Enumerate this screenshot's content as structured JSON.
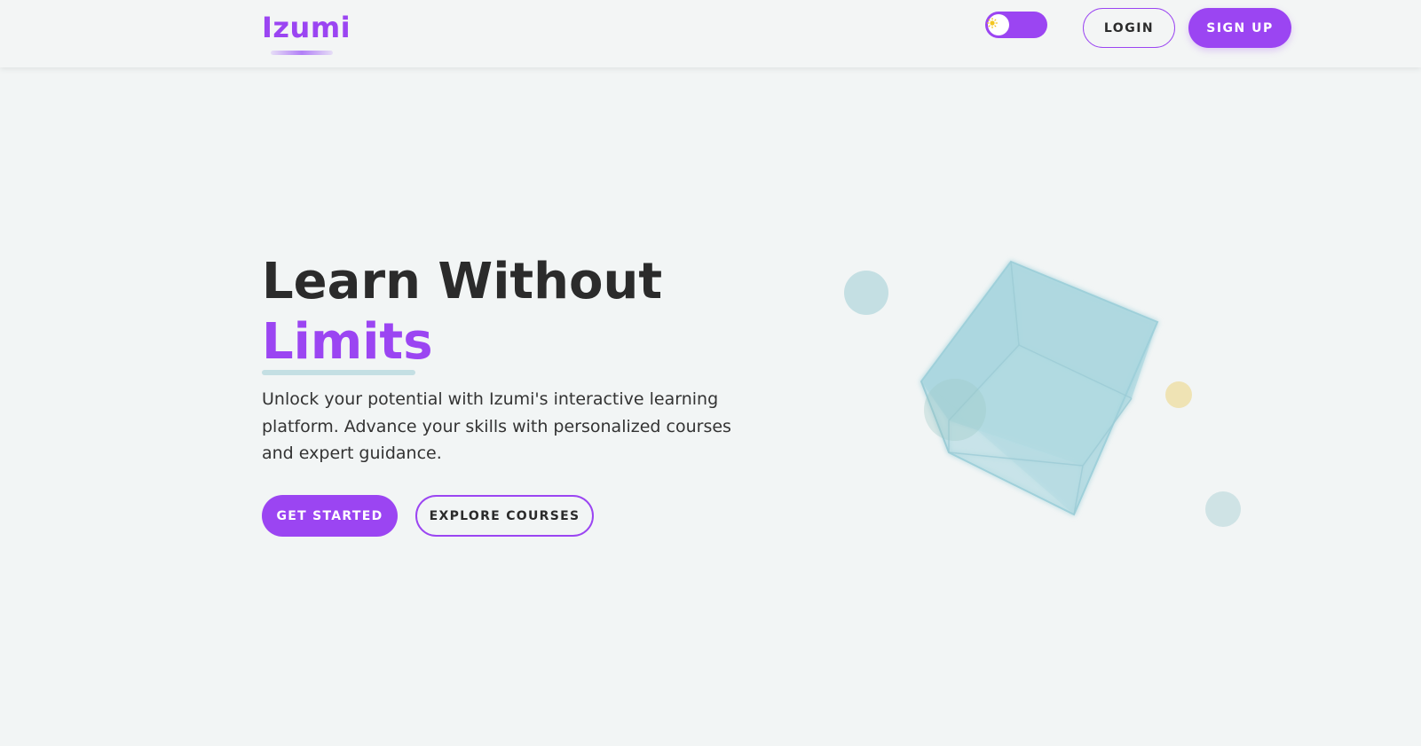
{
  "header": {
    "logo": "Izumi",
    "login_label": "LOGIN",
    "signup_label": "SIGN UP",
    "theme_toggle": {
      "state": "light",
      "icon": "sun-icon"
    }
  },
  "hero": {
    "title_line1": "Learn Without",
    "title_accent": "Limits",
    "description": "Unlock your potential with Izumi's interactive learning platform. Advance your skills with personalized courses and expert guidance.",
    "primary_cta": "GET STARTED",
    "secondary_cta": "EXPLORE COURSES"
  },
  "colors": {
    "accent": "#9b45f2",
    "background": "#f2f5f5",
    "text": "#2b2b2b",
    "cube": "#a9d6df",
    "dot_yellow": "#efe3b4"
  }
}
